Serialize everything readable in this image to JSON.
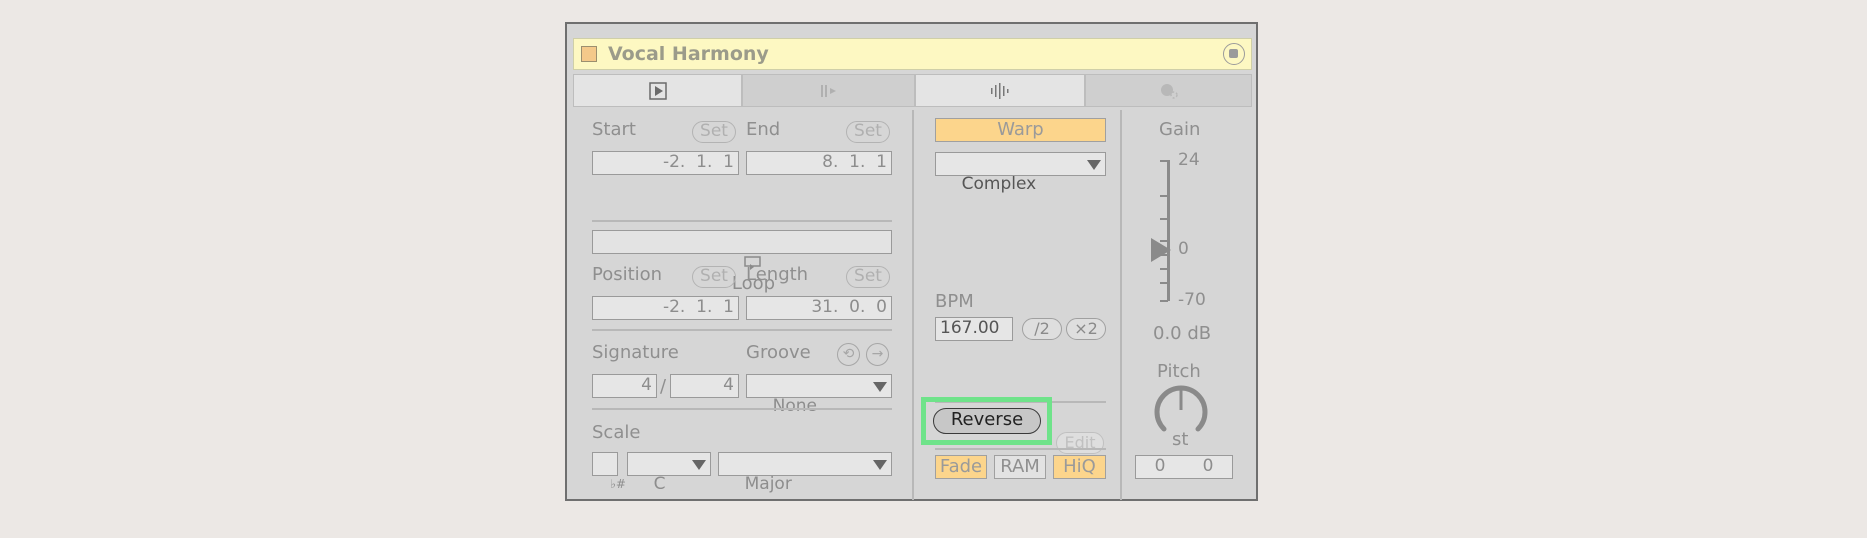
{
  "device": {
    "title": "Vocal Harmony",
    "tabs": [
      {
        "icon": "play-clip-icon",
        "active": true
      },
      {
        "icon": "envelope-icon",
        "active": false
      },
      {
        "icon": "waveform-icon",
        "active": true
      },
      {
        "icon": "launch-icon",
        "active": false
      }
    ]
  },
  "left": {
    "start_label": "Start",
    "end_label": "End",
    "set_label": "Set",
    "start_value": "-2.  1.  1",
    "end_value": "8.  1.  1",
    "loop_label": "Loop",
    "position_label": "Position",
    "length_label": "Length",
    "position_value": "-2.  1.  1",
    "length_value": "31.  0.  0",
    "signature_label": "Signature",
    "groove_label": "Groove",
    "sig_numerator": "4",
    "sig_slash": "/",
    "sig_denominator": "4",
    "groove_value": "None",
    "scale_label": "Scale",
    "scale_key": "C",
    "scale_mode": "Major",
    "accidental_symbol": "♭#"
  },
  "middle": {
    "warp_label": "Warp",
    "warp_mode": "Complex",
    "bpm_label": "BPM",
    "bpm_value": "167.00",
    "half_label": "/2",
    "double_label": "×2",
    "reverse_label": "Reverse",
    "edit_label": "Edit",
    "fade_label": "Fade",
    "ram_label": "RAM",
    "hiq_label": "HiQ"
  },
  "right": {
    "gain_label": "Gain",
    "gain_max": "24",
    "gain_mid": "0",
    "gain_min": "-70",
    "gain_value": "0.0 dB",
    "pitch_label": "Pitch",
    "pitch_unit": "st",
    "pitch_coarse": "0",
    "pitch_fine": "0"
  },
  "colors": {
    "highlight": "#6fe38a",
    "warp_on": "#fcd58c",
    "title_bg": "#fdf8c2"
  }
}
